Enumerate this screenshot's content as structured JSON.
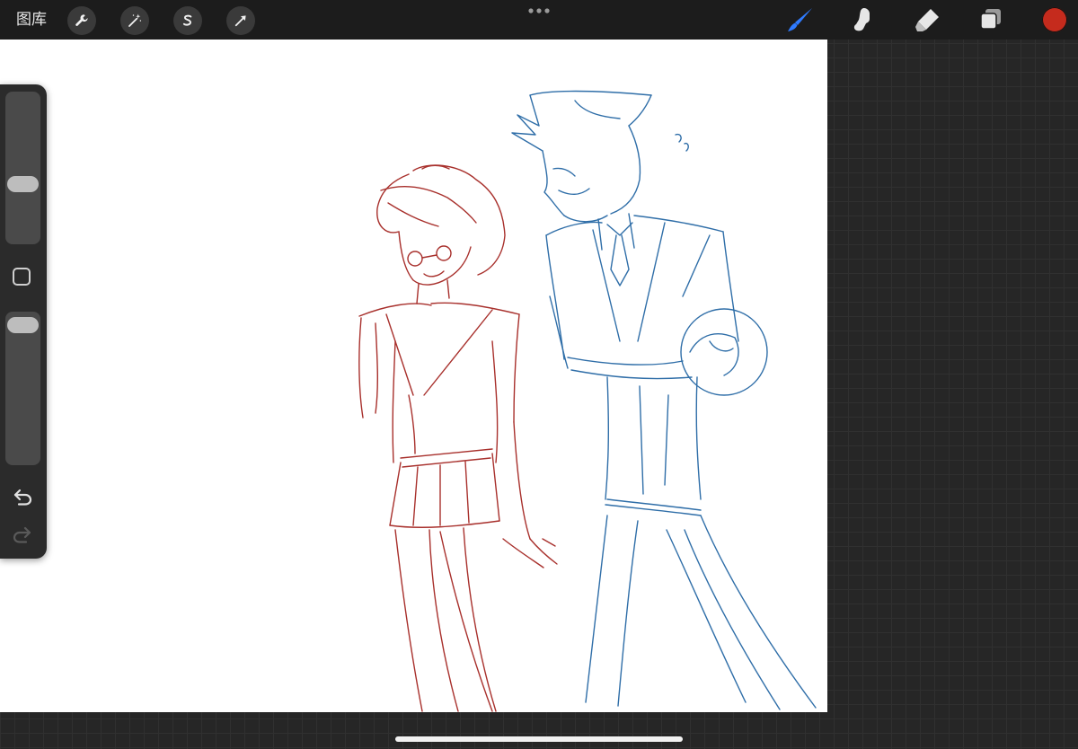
{
  "topbar": {
    "gallery_label": "图库",
    "left_tools": [
      "wrench-icon",
      "magic-wand-icon",
      "selection-icon",
      "transform-arrow-icon"
    ],
    "menu_icon": "more-dots-icon",
    "right_tools": [
      "brush-icon",
      "smudge-icon",
      "eraser-icon",
      "layers-icon"
    ],
    "active_tool": "brush",
    "current_color": "#c52b1d"
  },
  "sidebar": {
    "controls": [
      "brush-size-slider",
      "modify-button",
      "opacity-slider",
      "undo-button",
      "redo-button"
    ],
    "brush_size_fraction": 0.38,
    "opacity_fraction": 0.98,
    "redo_enabled": false
  },
  "canvas": {
    "background": "#ffffff",
    "sketch_colors": [
      "#a8302c",
      "#2f6ea8"
    ]
  },
  "colors": {
    "accent_blue": "#2f7bff",
    "toolbar_bg": "#1c1c1c",
    "panel_bg": "#2b2b2b"
  }
}
